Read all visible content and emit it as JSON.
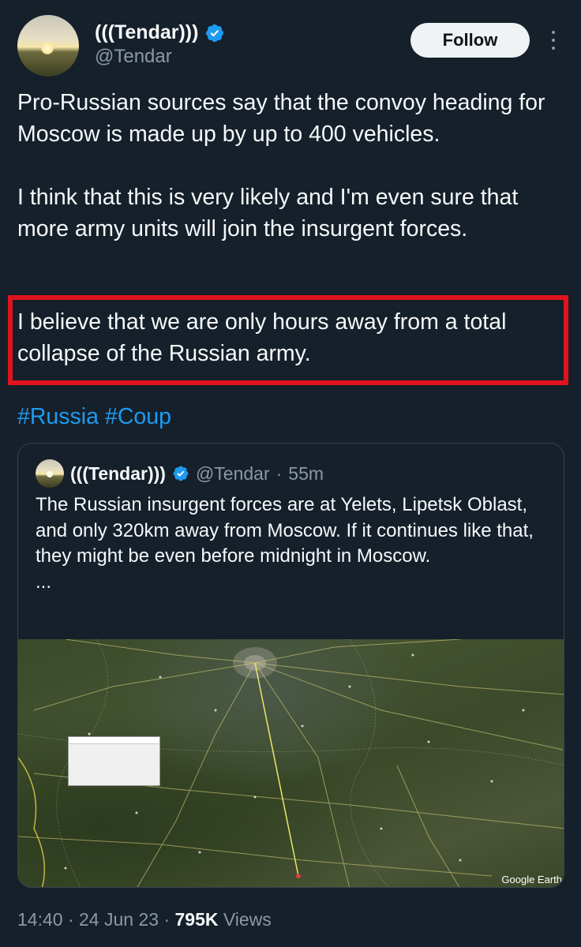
{
  "author": {
    "display_name": "(((Tendar)))",
    "handle": "@Tendar",
    "verified_icon": "verified-badge-icon",
    "follow_label": "Follow",
    "more_icon": "more-vertical-icon"
  },
  "tweet": {
    "paragraph1": "Pro-Russian sources say that the convoy heading for Moscow is made up by up to 400 vehicles.",
    "paragraph2": "I think that this is very likely and I'm even sure that more army units will join the insurgent forces.",
    "paragraph3": "I believe that we are only hours away from a total collapse of the Russian army.",
    "hashtags": [
      "#Russia",
      "#Coup"
    ],
    "highlight_color": "#e0141c"
  },
  "quote": {
    "display_name": "(((Tendar)))",
    "handle": "@Tendar",
    "separator": "·",
    "time": "55m",
    "text": "The Russian insurgent forces are at Yelets, Lipetsk Oblast, and only 320km away from Moscow. If it continues like that, they might be even before midnight in Moscow.",
    "ellipsis": "...",
    "map_credit": "Google Earth"
  },
  "footer": {
    "time": "14:40",
    "sep1": "·",
    "date": "24 Jun 23",
    "sep2": "·",
    "views_count": "795K",
    "views_label": "Views"
  },
  "colors": {
    "background": "#15202b",
    "text": "#f7f9f9",
    "muted": "#8b98a5",
    "link": "#1d9bf0",
    "verified": "#1d9bf0"
  }
}
